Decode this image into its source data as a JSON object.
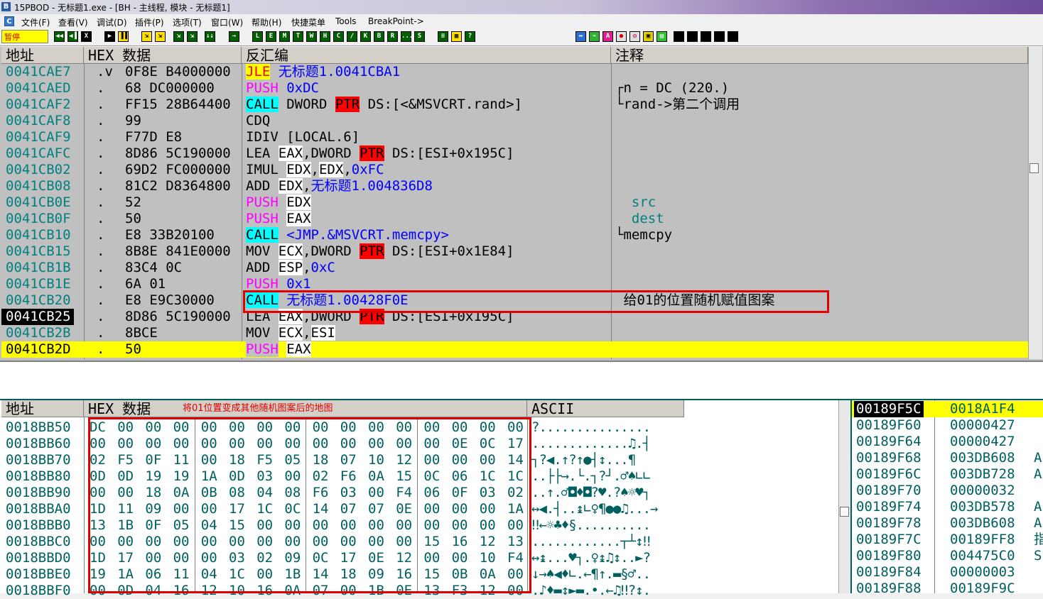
{
  "window": {
    "title": "15PBOD  - 无标题1.exe - [BH - 主线程, 模块 - 无标题1]"
  },
  "menu": [
    "文件(F)",
    "查看(V)",
    "调试(D)",
    "插件(P)",
    "选项(T)",
    "窗口(W)",
    "帮助(H)",
    "快捷菜单",
    "Tools",
    "BreakPoint->"
  ],
  "toolbar": {
    "status": "暂停",
    "group1": [
      "◀◀",
      "◀▐",
      "X"
    ],
    "group2": [
      "▶",
      "▐▐"
    ],
    "group3": [
      "⇲",
      "⇲",
      "⇲",
      "⇲",
      "↓↓",
      "→"
    ],
    "letters": [
      "L",
      "E",
      "M",
      "T",
      "W",
      "H",
      "C",
      "/",
      "K",
      "B",
      "R",
      "...",
      "S"
    ],
    "group4": [
      "≡",
      "▦",
      "?"
    ],
    "group5": [
      "↔",
      "⌁",
      "A",
      "●",
      "◎",
      "▣",
      "▤",
      " ",
      " ",
      " ",
      " ",
      " "
    ]
  },
  "disasm": {
    "headers": {
      "addr": "地址",
      "hex": "HEX 数据",
      "asm": "反汇编",
      "comment": "注释"
    },
    "rows": [
      {
        "addr": "0041CAE7",
        "mark": ".v",
        "hex": "0F8E B4000000",
        "asm": [
          {
            "t": "JLE",
            "c": "kw-jle"
          },
          {
            "t": " "
          },
          {
            "t": "无标题1.0041CBA1",
            "c": "blu"
          }
        ],
        "comment": ""
      },
      {
        "addr": "0041CAED",
        "mark": ".",
        "hex": "68 DC000000",
        "asm": [
          {
            "t": "PUSH",
            "c": "kw-push"
          },
          {
            "t": " "
          },
          {
            "t": "0xDC",
            "c": "blu"
          }
        ],
        "comment": "┌n = DC (220.)"
      },
      {
        "addr": "0041CAF2",
        "mark": ".",
        "hex": "FF15 28B64400",
        "asm": [
          {
            "t": "CALL",
            "c": "kw-call"
          },
          {
            "t": " DWORD "
          },
          {
            "t": "PTR",
            "c": "kw-ptr"
          },
          {
            "t": " DS:[<&MSVCRT.rand>]"
          }
        ],
        "comment": "└rand->第二个调用"
      },
      {
        "addr": "0041CAF8",
        "mark": ".",
        "hex": "99",
        "asm": [
          {
            "t": "CDQ"
          }
        ],
        "comment": ""
      },
      {
        "addr": "0041CAF9",
        "mark": ".",
        "hex": "F77D E8",
        "asm": [
          {
            "t": "IDIV [LOCAL.6]"
          }
        ],
        "comment": ""
      },
      {
        "addr": "0041CAFC",
        "mark": ".",
        "hex": "8D86 5C190000",
        "asm": [
          {
            "t": "LEA "
          },
          {
            "t": "EAX",
            "c": "reg"
          },
          {
            "t": ",DWORD "
          },
          {
            "t": "PTR",
            "c": "kw-ptr"
          },
          {
            "t": " DS:[ESI+0x195C]"
          }
        ],
        "comment": ""
      },
      {
        "addr": "0041CB02",
        "mark": ".",
        "hex": "69D2 FC000000",
        "asm": [
          {
            "t": "IMUL "
          },
          {
            "t": "EDX",
            "c": "reg"
          },
          {
            "t": ","
          },
          {
            "t": "EDX",
            "c": "reg"
          },
          {
            "t": ","
          },
          {
            "t": "0xFC",
            "c": "blu"
          }
        ],
        "comment": ""
      },
      {
        "addr": "0041CB08",
        "mark": ".",
        "hex": "81C2 D8364800",
        "asm": [
          {
            "t": "ADD "
          },
          {
            "t": "EDX",
            "c": "reg"
          },
          {
            "t": ","
          },
          {
            "t": "无标题1.004836D8",
            "c": "blu"
          }
        ],
        "comment": ""
      },
      {
        "addr": "0041CB0E",
        "mark": ".",
        "hex": "52",
        "asm": [
          {
            "t": "PUSH",
            "c": "kw-push"
          },
          {
            "t": " "
          },
          {
            "t": "EDX",
            "c": "reg"
          }
        ],
        "comment": "  src"
      },
      {
        "addr": "0041CB0F",
        "mark": ".",
        "hex": "50",
        "asm": [
          {
            "t": "PUSH",
            "c": "kw-push"
          },
          {
            "t": " "
          },
          {
            "t": "EAX",
            "c": "reg"
          }
        ],
        "comment": "  dest"
      },
      {
        "addr": "0041CB10",
        "mark": ".",
        "hex": "E8 33B20100",
        "asm": [
          {
            "t": "CALL",
            "c": "kw-call"
          },
          {
            "t": " "
          },
          {
            "t": "<JMP.&MSVCRT.memcpy>",
            "c": "blu"
          }
        ],
        "comment": "└memcpy"
      },
      {
        "addr": "0041CB15",
        "mark": ".",
        "hex": "8B8E 841E0000",
        "asm": [
          {
            "t": "MOV "
          },
          {
            "t": "ECX",
            "c": "reg"
          },
          {
            "t": ",DWORD "
          },
          {
            "t": "PTR",
            "c": "kw-ptr"
          },
          {
            "t": " DS:[ESI+0x1E84]"
          }
        ],
        "comment": ""
      },
      {
        "addr": "0041CB1B",
        "mark": ".",
        "hex": "83C4 0C",
        "asm": [
          {
            "t": "ADD "
          },
          {
            "t": "ESP",
            "c": "reg"
          },
          {
            "t": ","
          },
          {
            "t": "0xC",
            "c": "blu"
          }
        ],
        "comment": ""
      },
      {
        "addr": "0041CB1E",
        "mark": ".",
        "hex": "6A 01",
        "asm": [
          {
            "t": "PUSH",
            "c": "kw-push"
          },
          {
            "t": " "
          },
          {
            "t": "0x1",
            "c": "blu"
          }
        ],
        "comment": ""
      },
      {
        "addr": "0041CB20",
        "mark": ".",
        "hex": "E8 E9C30000",
        "asm": [
          {
            "t": "CALL",
            "c": "kw-call"
          },
          {
            "t": " "
          },
          {
            "t": "无标题1.00428F0E",
            "c": "blu"
          }
        ],
        "comment": " 给01的位置随机赋值图案"
      },
      {
        "addr": "0041CB25",
        "mark": ".",
        "hex": "8D86 5C190000",
        "asm": [
          {
            "t": "LEA "
          },
          {
            "t": "EAX",
            "c": "reg"
          },
          {
            "t": ",DWORD "
          },
          {
            "t": "PTR",
            "c": "kw-ptr"
          },
          {
            "t": " DS:[ESI+0x195C]"
          }
        ],
        "comment": "",
        "selected": true
      },
      {
        "addr": "0041CB2B",
        "mark": ".",
        "hex": "8BCE",
        "asm": [
          {
            "t": "MOV "
          },
          {
            "t": "ECX",
            "c": "reg"
          },
          {
            "t": ","
          },
          {
            "t": "ESI",
            "c": "reg"
          }
        ],
        "comment": ""
      },
      {
        "addr": "0041CB2D",
        "mark": ".",
        "hex": "50",
        "asm": [
          {
            "t": "PUSH",
            "c": "kw-push"
          },
          {
            "t": " "
          },
          {
            "t": "EAX",
            "c": "reg"
          }
        ],
        "comment": "",
        "current": true
      }
    ]
  },
  "dump": {
    "headers": {
      "addr": "地址",
      "hex": "HEX 数据",
      "ascii": "ASCII"
    },
    "annotation": "将01位置变成其他随机图案后的地图",
    "rows": [
      {
        "addr": "0018BB50",
        "bytes": [
          "DC",
          "00",
          "00",
          "00",
          "00",
          "00",
          "00",
          "00",
          "00",
          "00",
          "00",
          "00",
          "00",
          "00",
          "00",
          "00"
        ],
        "ascii": "?..............."
      },
      {
        "addr": "0018BB60",
        "bytes": [
          "00",
          "00",
          "00",
          "00",
          "00",
          "00",
          "00",
          "00",
          "00",
          "00",
          "00",
          "00",
          "00",
          "0E",
          "0C",
          "17"
        ],
        "ascii": ".............♫.┤"
      },
      {
        "addr": "0018BB70",
        "bytes": [
          "02",
          "F5",
          "0F",
          "11",
          "00",
          "18",
          "F5",
          "05",
          "18",
          "07",
          "10",
          "12",
          "00",
          "00",
          "00",
          "14"
        ],
        "ascii": "┐?◀.↑?↑●┤↕...¶"
      },
      {
        "addr": "0018BB80",
        "bytes": [
          "0D",
          "0D",
          "19",
          "19",
          "1A",
          "0D",
          "03",
          "00",
          "02",
          "F6",
          "0A",
          "15",
          "0C",
          "06",
          "1C",
          "1C"
        ],
        "ascii": "..├├→.└.┐?┘.♂♠∟∟"
      },
      {
        "addr": "0018BB90",
        "bytes": [
          "00",
          "00",
          "18",
          "0A",
          "0B",
          "08",
          "04",
          "08",
          "F6",
          "03",
          "00",
          "F4",
          "06",
          "0F",
          "03",
          "02"
        ],
        "ascii": "..↑.♂◘♦◘?♥.?♠☼♥┐"
      },
      {
        "addr": "0018BBA0",
        "bytes": [
          "1D",
          "11",
          "09",
          "00",
          "00",
          "17",
          "1C",
          "0C",
          "14",
          "07",
          "07",
          "0E",
          "00",
          "00",
          "00",
          "1A"
        ],
        "ascii": "↔◀.┤..↨∟♀¶●●♫...→"
      },
      {
        "addr": "0018BBB0",
        "bytes": [
          "13",
          "1B",
          "0F",
          "05",
          "04",
          "15",
          "00",
          "00",
          "00",
          "00",
          "00",
          "00",
          "00",
          "00",
          "00",
          "00"
        ],
        "ascii": "‼←☼♣♦§.........."
      },
      {
        "addr": "0018BBC0",
        "bytes": [
          "00",
          "00",
          "00",
          "00",
          "00",
          "00",
          "00",
          "00",
          "00",
          "00",
          "00",
          "00",
          "15",
          "16",
          "12",
          "13"
        ],
        "ascii": "............┬┴↕‼"
      },
      {
        "addr": "0018BBD0",
        "bytes": [
          "1D",
          "17",
          "00",
          "00",
          "00",
          "03",
          "02",
          "09",
          "0C",
          "17",
          "0E",
          "12",
          "00",
          "00",
          "10",
          "F4"
        ],
        "ascii": "↔↨...♥┐.♀↨♫↕..►?"
      },
      {
        "addr": "0018BBE0",
        "bytes": [
          "19",
          "1A",
          "06",
          "11",
          "04",
          "1C",
          "00",
          "1B",
          "14",
          "18",
          "09",
          "16",
          "15",
          "0B",
          "0A",
          "00"
        ],
        "ascii": "↓→♠◀♦∟.←¶↑.▬§♂.."
      },
      {
        "addr": "0018BBF0",
        "bytes": [
          "00",
          "0D",
          "04",
          "16",
          "12",
          "10",
          "16",
          "0A",
          "07",
          "00",
          "1B",
          "0E",
          "13",
          "F3",
          "12",
          "00"
        ],
        "ascii": ".♪♦▬↕►▬.•.←♫‼?↕."
      }
    ]
  },
  "stack": {
    "rows": [
      {
        "addr": "00189F5C",
        "value": "0018A1F4",
        "extra": "",
        "top": true
      },
      {
        "addr": "00189F60",
        "value": "00000427",
        "extra": ""
      },
      {
        "addr": "00189F64",
        "value": "00000427",
        "extra": ""
      },
      {
        "addr": "00189F68",
        "value": "003DB608",
        "extra": "A"
      },
      {
        "addr": "00189F6C",
        "value": "003DB728",
        "extra": "A"
      },
      {
        "addr": "00189F70",
        "value": "00000032",
        "extra": ""
      },
      {
        "addr": "00189F74",
        "value": "003DB578",
        "extra": "A"
      },
      {
        "addr": "00189F78",
        "value": "003DB608",
        "extra": "A"
      },
      {
        "addr": "00189F7C",
        "value": "00189FF8",
        "extra": "指"
      },
      {
        "addr": "00189F80",
        "value": "004475C0",
        "extra": "S"
      },
      {
        "addr": "00189F84",
        "value": "00000003",
        "extra": ""
      },
      {
        "addr": "00189F88",
        "value": "00189F9C",
        "extra": ""
      }
    ]
  },
  "colors": {
    "pane_bg": "#c0c0c0",
    "dump_bg": "#ffffff",
    "stack_bg": "#ffffff",
    "accent_red": "#e00000",
    "current_line": "#ffff00",
    "address_teal": "#008080"
  }
}
